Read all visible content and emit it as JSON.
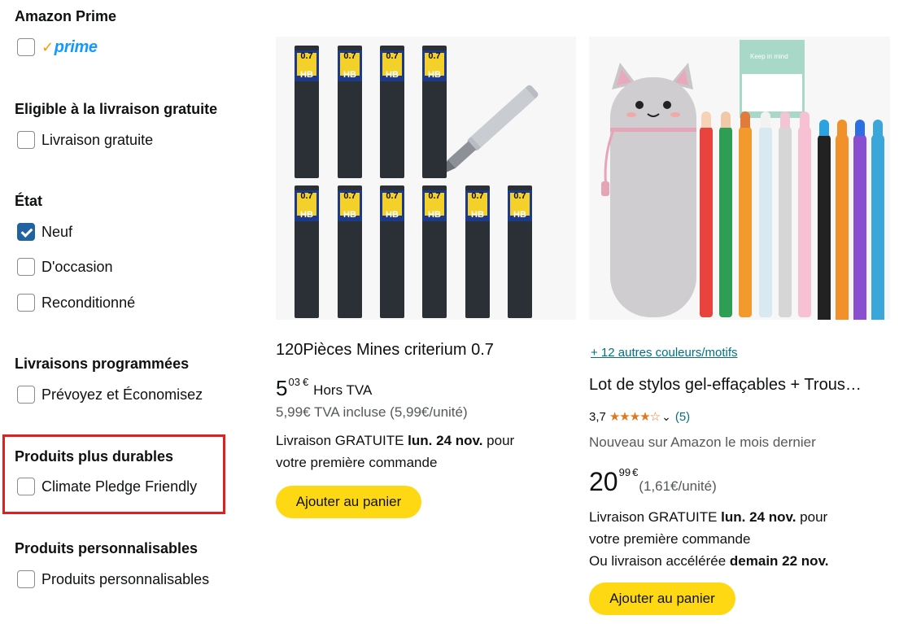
{
  "filters": {
    "prime": {
      "title": "Amazon Prime",
      "logo_check": "✓",
      "logo_text": "prime"
    },
    "free_shipping": {
      "title": "Eligible à la livraison gratuite",
      "option": "Livraison gratuite"
    },
    "condition": {
      "title": "État",
      "options": [
        {
          "label": "Neuf",
          "checked": true
        },
        {
          "label": "D'occasion",
          "checked": false
        },
        {
          "label": "Reconditionné",
          "checked": false
        }
      ]
    },
    "scheduled": {
      "title": "Livraisons programmées",
      "option": "Prévoyez et Économisez"
    },
    "durable": {
      "title": "Produits plus durables",
      "option": "Climate Pledge Friendly"
    },
    "customizable": {
      "title": "Produits personnalisables",
      "option": "Produits personnalisables"
    }
  },
  "products": [
    {
      "title": "120Pièces Mines criterium 0.7",
      "price_whole": "5",
      "price_fraction": "03",
      "price_symbol": "€",
      "price_suffix": "Hors TVA",
      "price_incl": "5,99€ TVA incluse (5,99€/unité)",
      "delivery_line1_prefix": "Livraison GRATUITE ",
      "delivery_line1_date": "lun. 24 nov.",
      "delivery_line1_suffix": " pour",
      "delivery_line2": "votre première commande",
      "button": "Ajouter au panier",
      "lead_label_value": "0.7",
      "lead_label_grade": "HB"
    },
    {
      "variants_link": "+ 12 autres couleurs/motifs",
      "title": "Lot de stylos gel-effaçables + Trous…",
      "rating": "3,7",
      "stars": "★★★★☆",
      "chevron": "⌄",
      "review_count": "(5)",
      "badge": "Nouveau sur Amazon le mois dernier",
      "price_whole": "20",
      "price_fraction": "99",
      "price_symbol": "€",
      "unit_price": "(1,61€/unité)",
      "delivery_line1_prefix": "Livraison GRATUITE ",
      "delivery_line1_date": "lun. 24 nov.",
      "delivery_line1_suffix": " pour",
      "delivery_line2": "votre première commande",
      "delivery_line3_prefix": "Ou livraison accélérée ",
      "delivery_line3_date": "demain 22 nov.",
      "button": "Ajouter au panier",
      "sticky_note_text": "Keep in mind"
    }
  ]
}
